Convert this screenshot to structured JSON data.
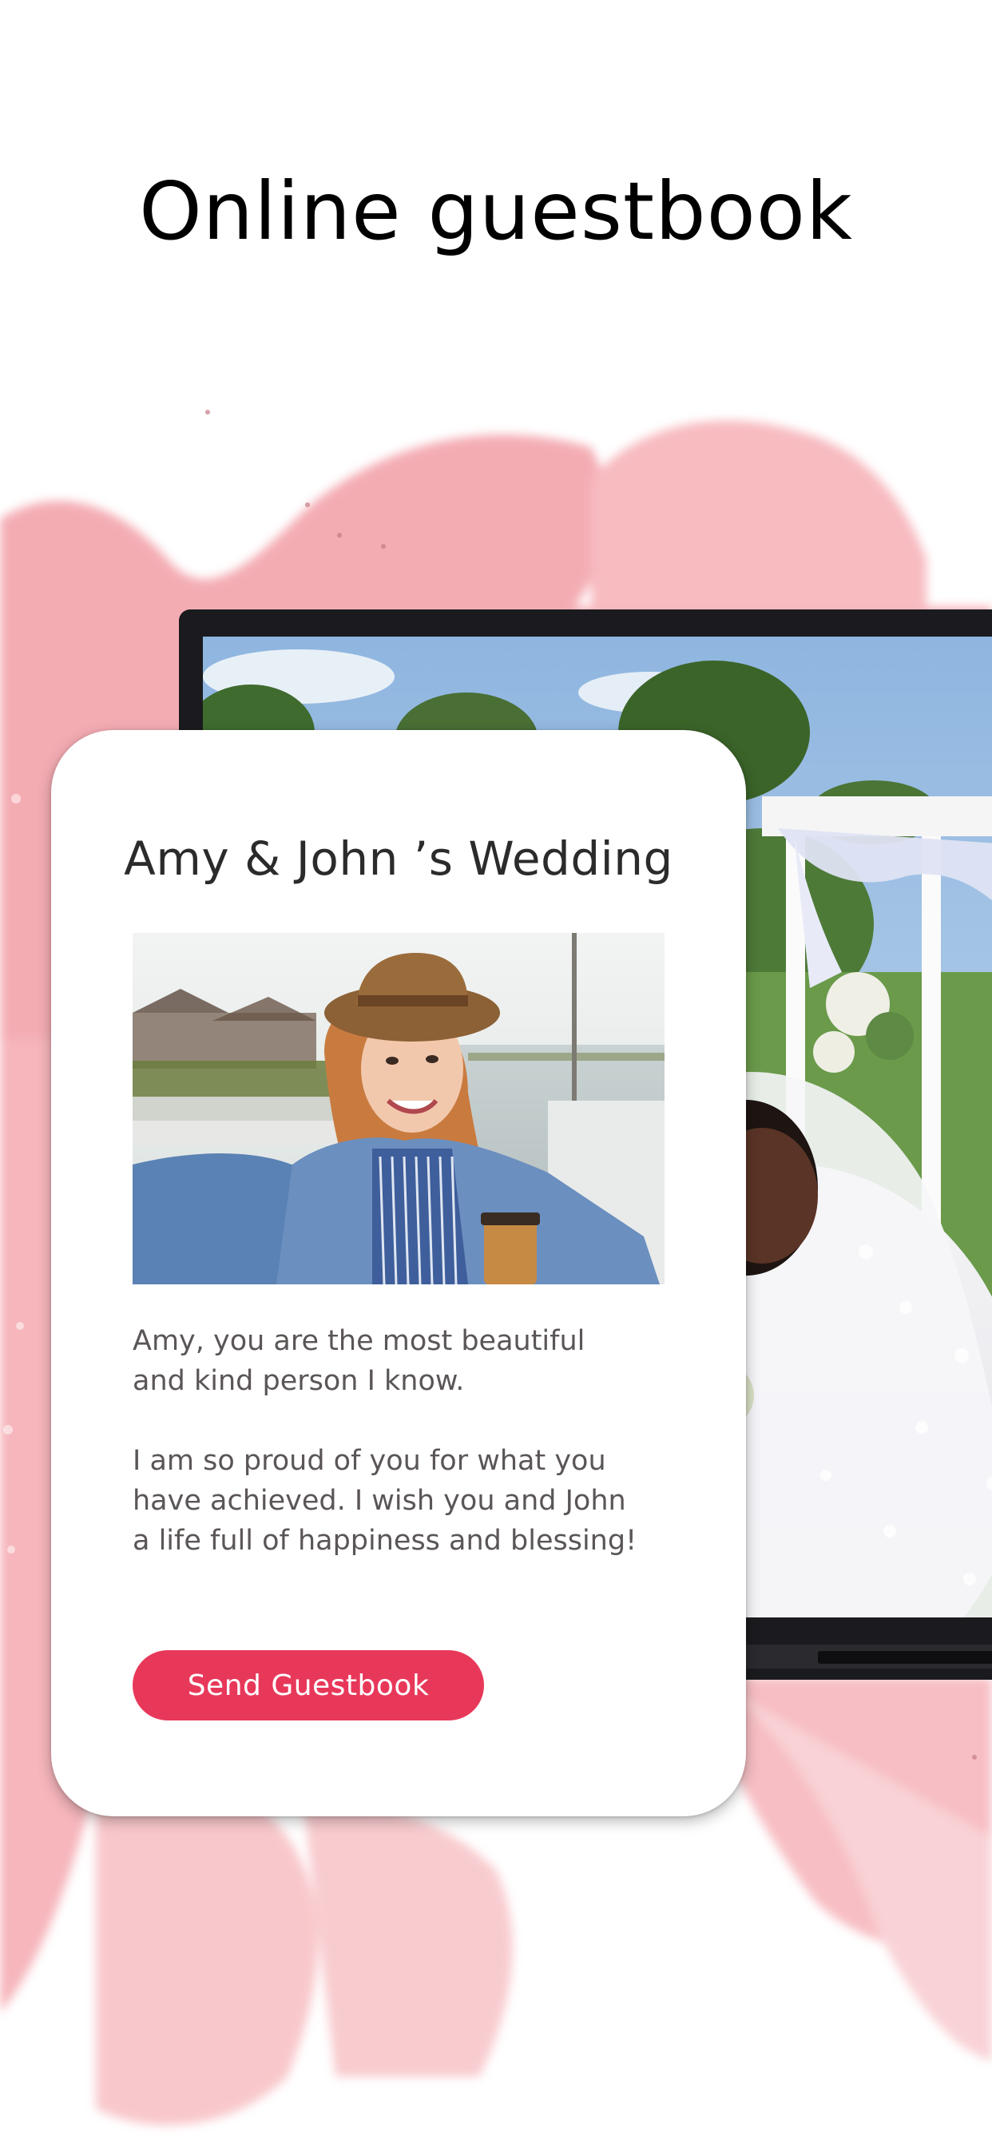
{
  "headline": "Online guestbook",
  "card": {
    "title": "Amy & John ’s Wedding",
    "message_paragraphs": [
      "Amy, you are the most beautiful and kind person I know.",
      "I am so proud of you for what you have achieved. I wish you and John a life full of happiness and blessing!"
    ],
    "send_button_label": "Send Guestbook"
  },
  "colors": {
    "accent": "#e8385a",
    "brush": "#f28a95",
    "headline_text": "#000000",
    "card_text": "#5b5656"
  },
  "icons": {
    "guest_photo": "selfie-photo",
    "monitor_photo": "wedding-photo"
  }
}
